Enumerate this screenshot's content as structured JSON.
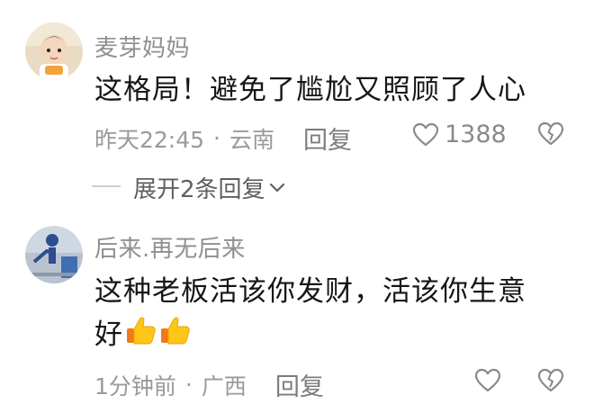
{
  "comments": [
    {
      "username": "麦芽妈妈",
      "text": "这格局！避免了尴尬又照顾了人心",
      "time": "昨天22:45",
      "separator": "·",
      "location": "云南",
      "reply_label": "回复",
      "like_count": "1388",
      "expand_label": "展开2条回复"
    },
    {
      "username": "后来.再无后来",
      "text_line1": "这种老板活该你发财，活该你生意",
      "text_line2": "好",
      "time": "1分钟前",
      "separator": "·",
      "location": "广西",
      "reply_label": "回复"
    }
  ],
  "icons": {
    "like": "heart-outline-icon",
    "dislike": "broken-heart-icon",
    "expand": "chevron-down-icon",
    "thumbs": "thumbs-up-emoji"
  },
  "colors": {
    "username": "#8f8f8f",
    "text": "#161616",
    "meta": "#9a9a9a",
    "thumb": "#f5b400"
  }
}
